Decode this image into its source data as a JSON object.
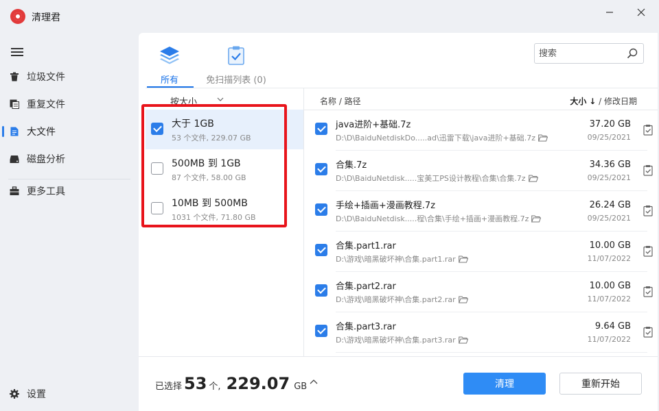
{
  "app": {
    "title": "清理君"
  },
  "sidebar": {
    "items": [
      {
        "label": "垃圾文件",
        "icon": "trash-icon"
      },
      {
        "label": "重复文件",
        "icon": "duplicate-icon"
      },
      {
        "label": "大文件",
        "icon": "large-file-icon",
        "active": true
      },
      {
        "label": "磁盘分析",
        "icon": "disk-icon"
      },
      {
        "label": "更多工具",
        "icon": "toolbox-icon"
      }
    ],
    "settings_label": "设置"
  },
  "tabs": [
    {
      "label": "所有",
      "icon": "layers-icon",
      "active": true
    },
    {
      "label": "免扫描列表 (0)",
      "icon": "clipboard-check-icon",
      "active": false
    }
  ],
  "search": {
    "placeholder": "搜索"
  },
  "categories": {
    "sort_label": "按大小",
    "items": [
      {
        "title": "大于 1GB",
        "subtitle": "53 个文件, 229.07 GB",
        "checked": true
      },
      {
        "title": "500MB 到 1GB",
        "subtitle": "87 个文件, 58.00 GB",
        "checked": false
      },
      {
        "title": "10MB 到 500MB",
        "subtitle": "1031 个文件, 71.80 GB",
        "checked": false
      }
    ]
  },
  "file_list": {
    "header_name": "名称 / 路径",
    "header_size": "大小",
    "header_arrow": "↓",
    "header_sep": " / ",
    "header_date": "修改日期",
    "rows": [
      {
        "name": "java进阶+基础.7z",
        "path": "D:\\D\\BaiduNetdiskDo.....ad\\迅雷下载\\java进阶+基础.7z",
        "size": "37.20 GB",
        "date": "09/25/2021",
        "checked": true
      },
      {
        "name": "合集.7z",
        "path": "D:\\D\\BaiduNetdisk.....宝美工PS设计教程\\合集\\合集.7z",
        "size": "34.36 GB",
        "date": "09/25/2021",
        "checked": true
      },
      {
        "name": "手绘+插画+漫画教程.7z",
        "path": "D:\\D\\BaiduNetdisk.....程\\合集\\手绘+插画+漫画教程.7z",
        "size": "26.24 GB",
        "date": "09/25/2021",
        "checked": true
      },
      {
        "name": "合集.part1.rar",
        "path": "D:\\游戏\\暗黑破坏神\\合集.part1.rar",
        "size": "10.00 GB",
        "date": "11/07/2022",
        "checked": true
      },
      {
        "name": "合集.part2.rar",
        "path": "D:\\游戏\\暗黑破坏神\\合集.part2.rar",
        "size": "10.00 GB",
        "date": "11/07/2022",
        "checked": true
      },
      {
        "name": "合集.part3.rar",
        "path": "D:\\游戏\\暗黑破坏神\\合集.part3.rar",
        "size": "9.64 GB",
        "date": "11/07/2022",
        "checked": true
      }
    ]
  },
  "footer": {
    "selected_prefix": "已选择",
    "count": "53",
    "count_unit": "个,",
    "size": "229.07",
    "size_unit": "GB",
    "clean_label": "清理",
    "restart_label": "重新开始"
  },
  "colors": {
    "accent": "#2b7de9",
    "highlight": "#e8141b",
    "selected_bg": "#e7f0fc"
  }
}
